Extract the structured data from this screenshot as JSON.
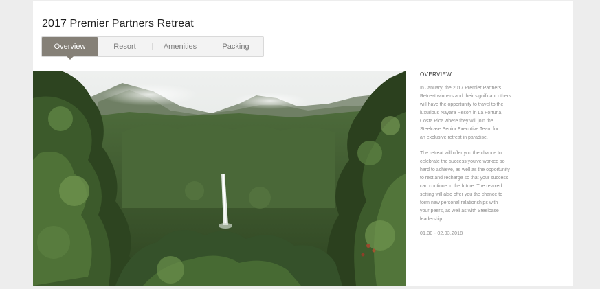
{
  "page": {
    "title": "2017 Premier Partners Retreat"
  },
  "tabs": [
    {
      "label": "Overview",
      "active": true
    },
    {
      "label": "Resort",
      "active": false
    },
    {
      "label": "Amenities",
      "active": false
    },
    {
      "label": "Packing",
      "active": false
    }
  ],
  "overview": {
    "heading": "OVERVIEW",
    "paragraph_1": "In January, the 2017 Premier Partners\nRetreat winners and their significant others\nwill have the opportunity to travel to the\nluxurious Nayara Resort in La Fortuna,\nCosta Rica where they will join the\nSteelcase Senior Executive Team for\nan exclusive retreat in paradise.",
    "paragraph_2": "The retreat will offer you the chance to\ncelebrate the success you've worked so\nhard to achieve, as well as the opportunity\nto rest and recharge so that your success\ncan continue in the future. The relaxed\nsetting will also offer you the chance to\nform new personal relationships with\nyour peers, as well as with Steelcase\nleadership.",
    "dates": "01.30 - 02.03.2018"
  },
  "colors": {
    "page_background": "#ededed",
    "active_tab": "#858077",
    "forest_dark": "#2f4422",
    "forest_light": "#6e8a4f",
    "sky": "#e9eaea"
  }
}
